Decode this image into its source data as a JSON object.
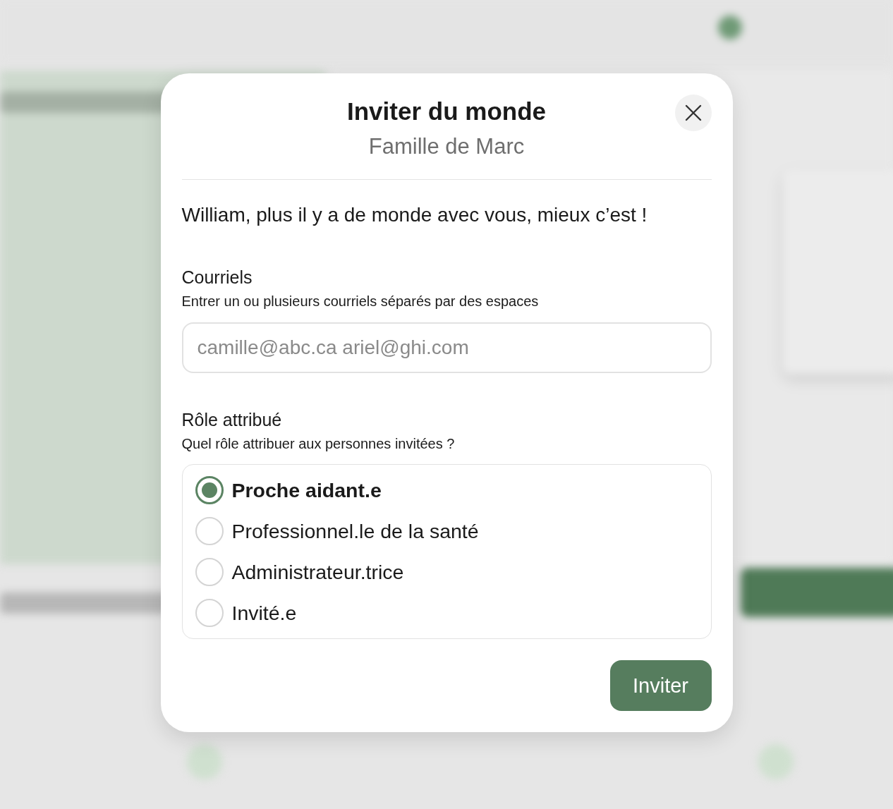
{
  "dialog": {
    "title": "Inviter du monde",
    "subtitle": "Famille de Marc",
    "intro": "William, plus il y a de monde avec vous, mieux c’est !",
    "emails": {
      "label": "Courriels",
      "hint": "Entrer un ou plusieurs courriels séparés par des espaces",
      "placeholder": "camille@abc.ca ariel@ghi.com"
    },
    "role": {
      "label": "Rôle attribué",
      "hint": "Quel rôle attribuer aux personnes invitées ?",
      "options": [
        {
          "label": "Proche aidant.e",
          "selected": true
        },
        {
          "label": "Professionnel.le de la santé",
          "selected": false
        },
        {
          "label": "Administrateur.trice",
          "selected": false
        },
        {
          "label": "Invité.e",
          "selected": false
        }
      ]
    },
    "submit": "Inviter"
  }
}
